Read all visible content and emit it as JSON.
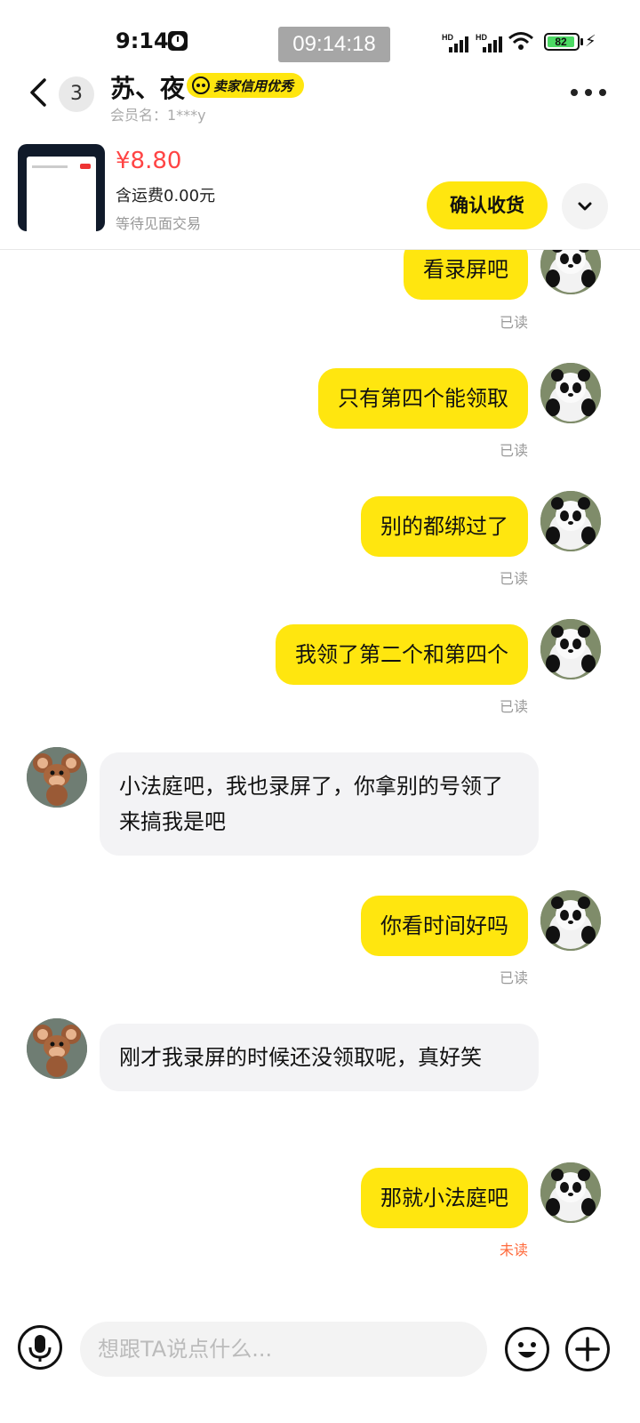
{
  "status_bar": {
    "time": "9:14",
    "overlay_time": "09:14:18",
    "signal_label": "HD",
    "battery": "82"
  },
  "header": {
    "unread_count": "3",
    "seller_name": "苏、夜",
    "credit_badge": "卖家信用优秀",
    "member_name": "会员名：1***y"
  },
  "product": {
    "price": "¥8.80",
    "shipping": "含运费0.00元",
    "status": "等待见面交易",
    "confirm_button": "确认收货"
  },
  "messages": [
    {
      "from": "me",
      "text": "看录屏吧",
      "receipt": "已读"
    },
    {
      "from": "me",
      "text": "只有第四个能领取",
      "receipt": "已读"
    },
    {
      "from": "me",
      "text": "别的都绑过了",
      "receipt": "已读"
    },
    {
      "from": "me",
      "text": "我领了第二个和第四个",
      "receipt": "已读"
    },
    {
      "from": "other",
      "text": "小法庭吧，我也录屏了，你拿别的号领了来搞我是吧"
    },
    {
      "from": "me",
      "text": "你看时间好吗",
      "receipt": "已读"
    },
    {
      "from": "other",
      "text": "刚才我录屏的时候还没领取呢，真好笑"
    },
    {
      "from": "me",
      "text": "那就小法庭吧",
      "receipt": "未读"
    }
  ],
  "input": {
    "placeholder": "想跟TA说点什么..."
  },
  "colors": {
    "accent": "#ffe60f",
    "price": "#ff4444",
    "unread": "#ff6b3d"
  },
  "icons": [
    "back-icon",
    "more-icon",
    "chevron-down-icon",
    "mic-icon",
    "emoji-icon",
    "plus-icon"
  ]
}
